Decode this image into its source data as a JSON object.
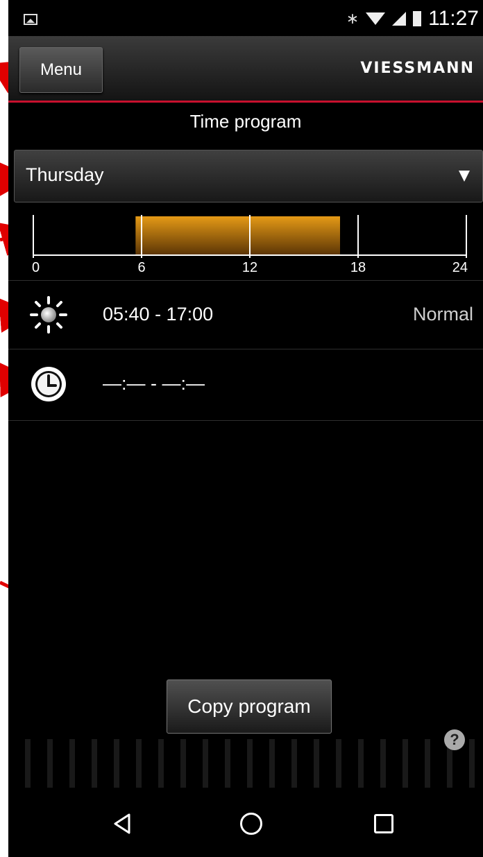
{
  "status_bar": {
    "time": "11:27",
    "icons": [
      "image-icon",
      "bluetooth-icon",
      "wifi-icon",
      "signal-icon",
      "battery-icon"
    ]
  },
  "header": {
    "menu_label": "Menu",
    "brand": "VIESSMANN",
    "accent_color": "#c8102e"
  },
  "page_title": "Time program",
  "day_selector": {
    "selected": "Thursday",
    "icon": "dropdown-arrow-icon"
  },
  "timeline": {
    "ticks": [
      "0",
      "6",
      "12",
      "18",
      "24"
    ],
    "active_start_hour": 5.667,
    "active_end_hour": 17.0,
    "bar_color": "#d4870f"
  },
  "schedule": [
    {
      "icon": "sun-icon",
      "time_range": "05:40 - 17:00",
      "mode": "Normal"
    },
    {
      "icon": "clock-icon",
      "time_range": "—:— - —:—",
      "mode": ""
    }
  ],
  "copy_button": "Copy program",
  "help_icon": "?",
  "nav": [
    "back-icon",
    "home-icon",
    "recent-apps-icon"
  ]
}
